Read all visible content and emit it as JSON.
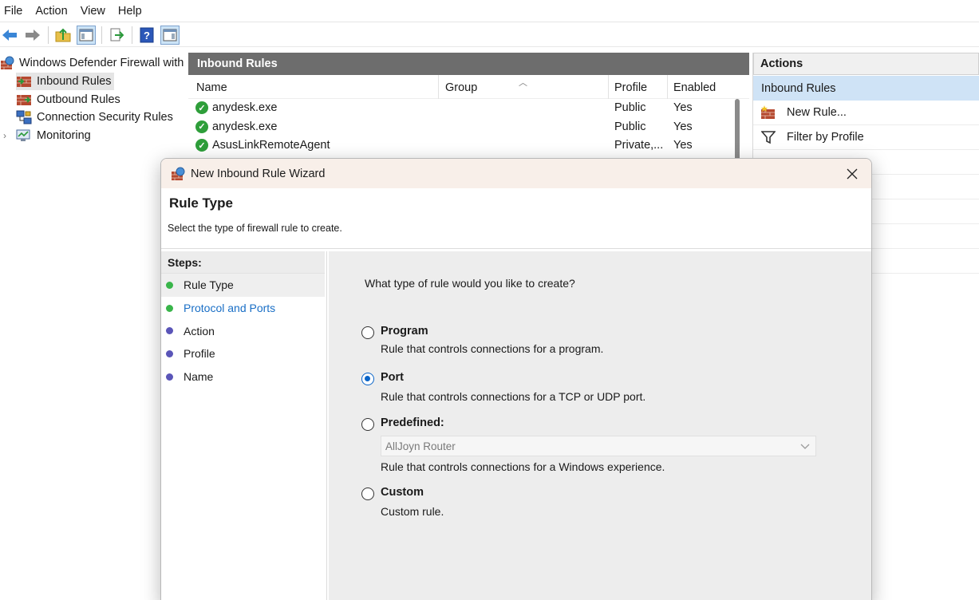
{
  "menubar": {
    "items": [
      "File",
      "Action",
      "View",
      "Help"
    ]
  },
  "toolbar": {
    "icons": [
      "back-arrow-icon",
      "forward-arrow-icon",
      "up-folder-icon",
      "show-hide-tree-icon",
      "export-list-icon",
      "help-icon",
      "show-hide-action-pane-icon"
    ]
  },
  "tree": {
    "root": "Windows Defender Firewall with Advanced Security",
    "items": [
      "Inbound Rules",
      "Outbound Rules",
      "Connection Security Rules",
      "Monitoring"
    ]
  },
  "rules_panel": {
    "title": "Inbound Rules",
    "columns": [
      "Name",
      "Group",
      "Profile",
      "Enabled"
    ],
    "rows": [
      {
        "name": "anydesk.exe",
        "group": "",
        "profile": "Public",
        "enabled": "Yes"
      },
      {
        "name": "anydesk.exe",
        "group": "",
        "profile": "Public",
        "enabled": "Yes"
      },
      {
        "name": "AsusLinkRemoteAgent",
        "group": "",
        "profile": "Private,...",
        "enabled": "Yes"
      }
    ]
  },
  "actions_panel": {
    "title": "Actions",
    "section": "Inbound Rules",
    "items": [
      "New Rule...",
      "Filter by Profile"
    ]
  },
  "wizard": {
    "window_title": "New Inbound Rule Wizard",
    "header_title": "Rule Type",
    "header_subtitle": "Select the type of firewall rule to create.",
    "steps_title": "Steps:",
    "steps": [
      "Rule Type",
      "Protocol and Ports",
      "Action",
      "Profile",
      "Name"
    ],
    "question": "What type of rule would you like to create?",
    "options": [
      {
        "label": "Program",
        "description": "Rule that controls connections for a program.",
        "selected": false
      },
      {
        "label": "Port",
        "description": "Rule that controls connections for a TCP or UDP port.",
        "selected": true
      },
      {
        "label": "Predefined:",
        "description": "Rule that controls connections for a Windows experience.",
        "selected": false
      },
      {
        "label": "Custom",
        "description": "Custom rule.",
        "selected": false
      }
    ],
    "predefined_select_value": "AllJoyn Router"
  }
}
